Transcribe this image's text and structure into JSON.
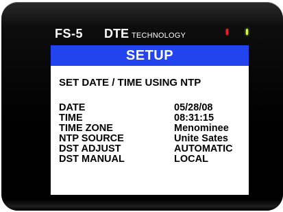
{
  "device": {
    "model": "FS-5",
    "brand": "DTE",
    "brand_sub": "TECHNOLOGY",
    "led_colors": {
      "left": "#e0242a",
      "right": "#d6ff3a"
    }
  },
  "screen": {
    "header": "SETUP",
    "header_color": "#2244ee",
    "subtitle": "SET DATE / TIME USING NTP",
    "rows": [
      {
        "label": "DATE",
        "value": "05/28/08"
      },
      {
        "label": "TIME",
        "value": "08:31:15"
      },
      {
        "label": "TIME ZONE",
        "value": "Menominee"
      },
      {
        "label": "NTP SOURCE",
        "value": "Unite Sates"
      },
      {
        "label": "DST ADJUST",
        "value": "AUTOMATIC"
      },
      {
        "label": "DST MANUAL",
        "value": "LOCAL"
      }
    ]
  }
}
